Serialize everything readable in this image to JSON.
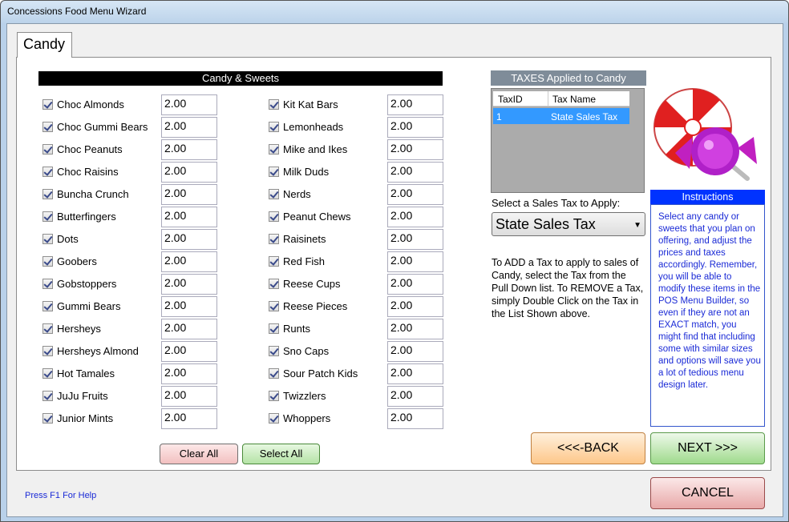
{
  "window": {
    "title": "Concessions Food Menu Wizard"
  },
  "tab": {
    "label": "Candy"
  },
  "section": {
    "header": "Candy & Sweets"
  },
  "candy_left": [
    {
      "name": "Choc Almonds",
      "price": "2.00",
      "checked": true
    },
    {
      "name": "Choc Gummi Bears",
      "price": "2.00",
      "checked": true
    },
    {
      "name": "Choc Peanuts",
      "price": "2.00",
      "checked": true
    },
    {
      "name": "Choc Raisins",
      "price": "2.00",
      "checked": true
    },
    {
      "name": "Buncha Crunch",
      "price": "2.00",
      "checked": true
    },
    {
      "name": "Butterfingers",
      "price": "2.00",
      "checked": true
    },
    {
      "name": "Dots",
      "price": "2.00",
      "checked": true
    },
    {
      "name": "Goobers",
      "price": "2.00",
      "checked": true
    },
    {
      "name": "Gobstoppers",
      "price": "2.00",
      "checked": true
    },
    {
      "name": "Gummi Bears",
      "price": "2.00",
      "checked": true
    },
    {
      "name": "Hersheys",
      "price": "2.00",
      "checked": true
    },
    {
      "name": "Hersheys Almond",
      "price": "2.00",
      "checked": true
    },
    {
      "name": "Hot Tamales",
      "price": "2.00",
      "checked": true
    },
    {
      "name": "JuJu Fruits",
      "price": "2.00",
      "checked": true
    },
    {
      "name": "Junior Mints",
      "price": "2.00",
      "checked": true
    }
  ],
  "candy_right": [
    {
      "name": "Kit Kat Bars",
      "price": "2.00",
      "checked": true
    },
    {
      "name": "Lemonheads",
      "price": "2.00",
      "checked": true
    },
    {
      "name": "Mike and Ikes",
      "price": "2.00",
      "checked": true
    },
    {
      "name": "Milk Duds",
      "price": "2.00",
      "checked": true
    },
    {
      "name": "Nerds",
      "price": "2.00",
      "checked": true
    },
    {
      "name": "Peanut Chews",
      "price": "2.00",
      "checked": true
    },
    {
      "name": "Raisinets",
      "price": "2.00",
      "checked": true
    },
    {
      "name": "Red Fish",
      "price": "2.00",
      "checked": true
    },
    {
      "name": "Reese Cups",
      "price": "2.00",
      "checked": true
    },
    {
      "name": "Reese Pieces",
      "price": "2.00",
      "checked": true
    },
    {
      "name": "Runts",
      "price": "2.00",
      "checked": true
    },
    {
      "name": "Sno Caps",
      "price": "2.00",
      "checked": true
    },
    {
      "name": "Sour Patch Kids",
      "price": "2.00",
      "checked": true
    },
    {
      "name": "Twizzlers",
      "price": "2.00",
      "checked": true
    },
    {
      "name": "Whoppers",
      "price": "2.00",
      "checked": true
    }
  ],
  "buttons": {
    "clear_all": "Clear All",
    "select_all": "Select All",
    "back": "<<<-BACK",
    "next": "NEXT >>>",
    "cancel": "CANCEL"
  },
  "taxes": {
    "header": "TAXES Applied to Candy",
    "columns": [
      "TaxID",
      "Tax Name"
    ],
    "rows": [
      {
        "id": "1",
        "name": "State Sales Tax"
      }
    ],
    "select_label": "Select a Sales Tax to Apply:",
    "selected": "State Sales Tax",
    "help": "To ADD a Tax to apply to sales of Candy, select the Tax from the Pull Down list.  To REMOVE a Tax, simply Double Click on the Tax in the List Shown above."
  },
  "instructions": {
    "header": "Instructions",
    "text": "Select any candy or sweets that you plan on offering, and adjust the prices and taxes accordingly. Remember, you will be able to modify these items in the POS Menu Builder, so even if they are not an EXACT match, you might find that including some with similar sizes and options will save you a lot of tedious menu design later."
  },
  "footer": {
    "help": "Press F1 For Help"
  },
  "colors": {
    "instructions_text": "#1a2ad6",
    "instructions_header": "#0033ff",
    "selection": "#3399ff"
  },
  "icons": {
    "candy_image": "peppermint-and-wrapped-candy"
  }
}
